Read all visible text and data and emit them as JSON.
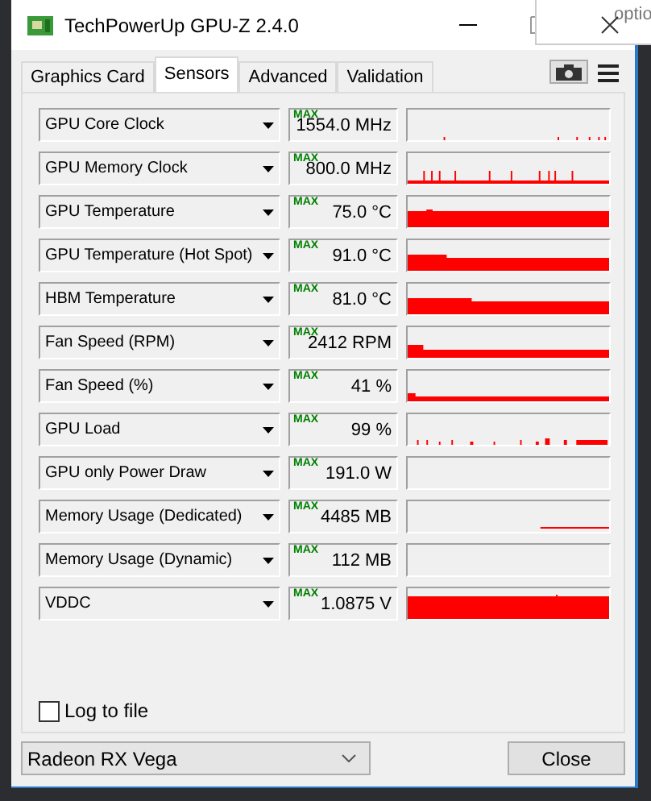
{
  "window": {
    "title": "TechPowerUp GPU-Z 2.4.0"
  },
  "tooltip": {
    "text": "optio"
  },
  "tabs": [
    {
      "label": "Graphics Card",
      "selected": false
    },
    {
      "label": "Sensors",
      "selected": true
    },
    {
      "label": "Advanced",
      "selected": false
    },
    {
      "label": "Validation",
      "selected": false
    }
  ],
  "sensors": [
    {
      "name": "GPU Core Clock",
      "max_label": "MAX",
      "value": "1554.0 MHz"
    },
    {
      "name": "GPU Memory Clock",
      "max_label": "MAX",
      "value": "800.0 MHz"
    },
    {
      "name": "GPU Temperature",
      "max_label": "MAX",
      "value": "75.0 °C"
    },
    {
      "name": "GPU Temperature (Hot Spot)",
      "max_label": "MAX",
      "value": "91.0 °C"
    },
    {
      "name": "HBM Temperature",
      "max_label": "MAX",
      "value": "81.0 °C"
    },
    {
      "name": "Fan Speed (RPM)",
      "max_label": "MAX",
      "value": "2412 RPM"
    },
    {
      "name": "Fan Speed (%)",
      "max_label": "MAX",
      "value": "41 %"
    },
    {
      "name": "GPU Load",
      "max_label": "MAX",
      "value": "99 %"
    },
    {
      "name": "GPU only Power Draw",
      "max_label": "MAX",
      "value": "191.0 W"
    },
    {
      "name": "Memory Usage (Dedicated)",
      "max_label": "MAX",
      "value": "4485 MB"
    },
    {
      "name": "Memory Usage (Dynamic)",
      "max_label": "MAX",
      "value": "112 MB"
    },
    {
      "name": "VDDC",
      "max_label": "MAX",
      "value": "1.0875 V"
    }
  ],
  "log_to_file": {
    "label": "Log to file",
    "checked": false
  },
  "device_select": {
    "value": "Radeon RX Vega"
  },
  "buttons": [
    {
      "label": "Close"
    }
  ]
}
